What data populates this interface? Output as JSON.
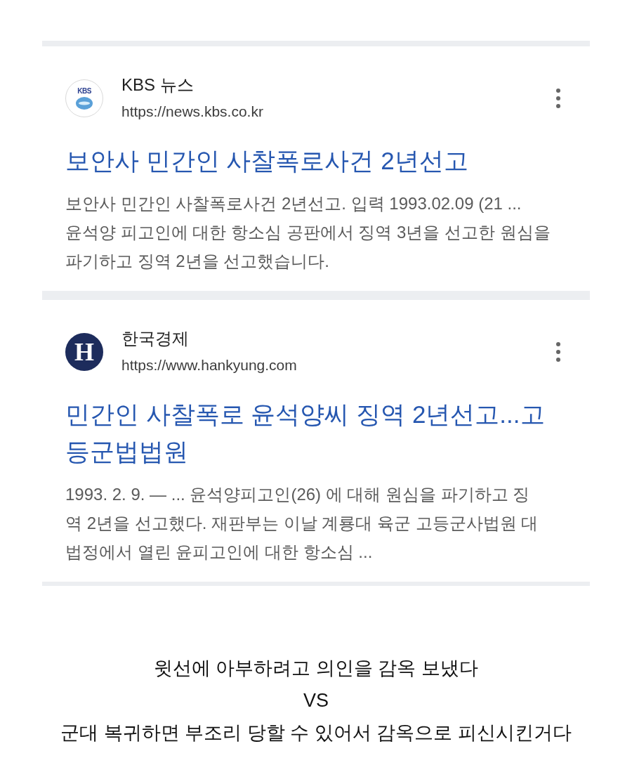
{
  "results": [
    {
      "source": {
        "name": "KBS 뉴스",
        "url": "https://news.kbs.co.kr",
        "logo": {
          "kind": "wordmark",
          "text": "KBS"
        }
      },
      "title_lines": [
        "보안사 민간인 사찰폭로사건 2년선고"
      ],
      "snippet_lines": [
        "보안사 민간인 사찰폭로사건 2년선고. 입력 1993.02.09 (21 ...",
        "윤석양 피고인에 대한 항소심 공판에서 징역 3년을 선고한 원심을",
        "파기하고 징역 2년을 선고했습니다."
      ]
    },
    {
      "source": {
        "name": "한국경제",
        "url": "https://www.hankyung.com",
        "logo": {
          "kind": "letter",
          "text": "H"
        }
      },
      "title_lines": [
        "민간인 사찰폭로 윤석양씨 징역 2년선고...고",
        "등군법법원"
      ],
      "snippet_lines": [
        "1993. 2. 9. — ... 윤석양피고인(26) 에 대해 원심을 파기하고 징",
        "역 2년을 선고했다. 재판부는 이날 계룡대 육군 고등군사법원 대",
        "법정에서 열린 윤피고인에 대한 항소심 ..."
      ]
    }
  ],
  "caption": [
    "윗선에 아부하려고 의인을 감옥 보냈다",
    "VS",
    "군대 복귀하면 부조리 당할 수 있어서 감옥으로 피신시킨거다"
  ]
}
